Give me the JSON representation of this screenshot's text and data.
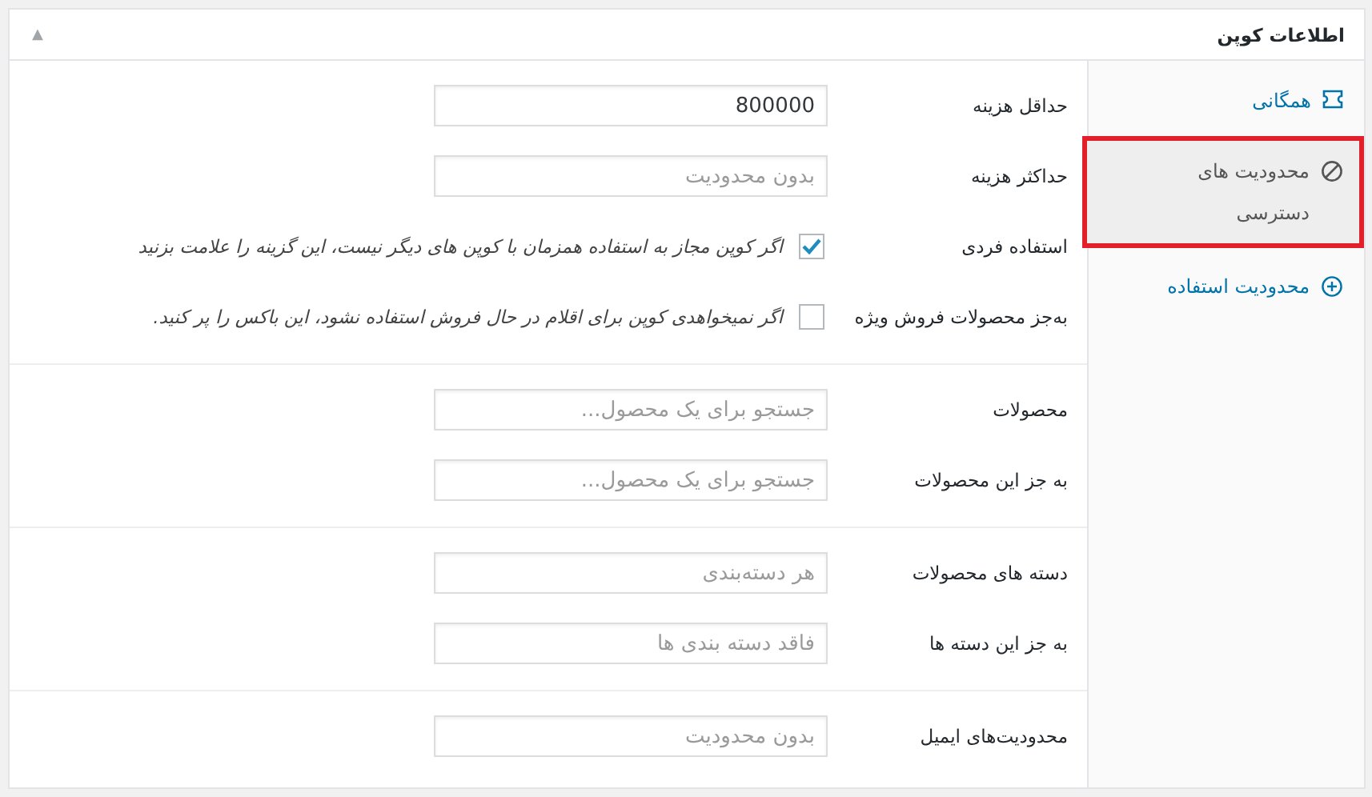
{
  "panel": {
    "title": "اطلاعات کوپن",
    "collapse_icon": "▲"
  },
  "tabs": [
    {
      "label": "همگانی",
      "kind": "general",
      "selected": false
    },
    {
      "label": "محدودیت های دسترسی",
      "kind": "restriction",
      "selected": true
    },
    {
      "label": "محدودیت استفاده",
      "kind": "limit",
      "selected": false
    }
  ],
  "sections": [
    {
      "fields": [
        {
          "kind": "text",
          "label": "حداقل هزینه",
          "value": "800000"
        },
        {
          "kind": "text",
          "label": "حداکثر هزینه",
          "placeholder": "بدون محدودیت"
        },
        {
          "kind": "checkbox",
          "label": "استفاده فردی",
          "checked": true,
          "description": "اگر کوپن مجاز به استفاده همزمان با کوپن های دیگر نیست، این گزینه را علامت بزنید"
        },
        {
          "kind": "checkbox",
          "label": "به‌جز محصولات فروش ویژه",
          "checked": false,
          "description": "اگر نمیخواهدی کوپن برای اقلام در حال فروش استفاده نشود، این باکس را پر کنید."
        }
      ]
    },
    {
      "fields": [
        {
          "kind": "text",
          "label": "محصولات",
          "placeholder": "جستجو برای یک محصول..."
        },
        {
          "kind": "text",
          "label": "به جز این محصولات",
          "placeholder": "جستجو برای یک محصول..."
        }
      ]
    },
    {
      "fields": [
        {
          "kind": "text",
          "label": "دسته های محصولات",
          "placeholder": "هر دسته‌بندی"
        },
        {
          "kind": "text",
          "label": "به جز این دسته ها",
          "placeholder": "فاقد دسته بندی ها"
        }
      ]
    },
    {
      "fields": [
        {
          "kind": "text",
          "label": "محدودیت‌های ایمیل",
          "placeholder": "بدون محدودیت"
        }
      ]
    }
  ]
}
